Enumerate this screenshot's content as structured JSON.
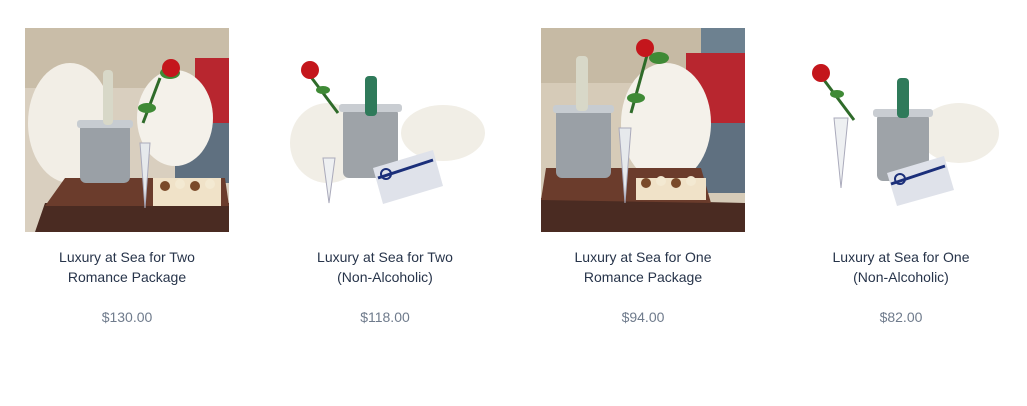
{
  "products": [
    {
      "title_line1": "Luxury at Sea for Two",
      "title_line2": "Romance Package",
      "price": "$130.00",
      "image": "bathrobes-champagne-bucket-rose-chocolates-interior-icon"
    },
    {
      "title_line1": "Luxury at Sea for Two",
      "title_line2": "(Non-Alcoholic)",
      "price": "$118.00",
      "image": "bathrobes-bucket-rose-gift-box-white-icon"
    },
    {
      "title_line1": "Luxury at Sea for One",
      "title_line2": "Romance Package",
      "price": "$94.00",
      "image": "bathrobe-champagne-bucket-rose-chocolates-interior-icon"
    },
    {
      "title_line1": "Luxury at Sea for One",
      "title_line2": "(Non-Alcoholic)",
      "price": "$82.00",
      "image": "bathrobe-bucket-rose-gift-box-white-icon"
    }
  ],
  "colors": {
    "title": "#27344a",
    "price": "#6f7b8c",
    "background": "#ffffff"
  }
}
